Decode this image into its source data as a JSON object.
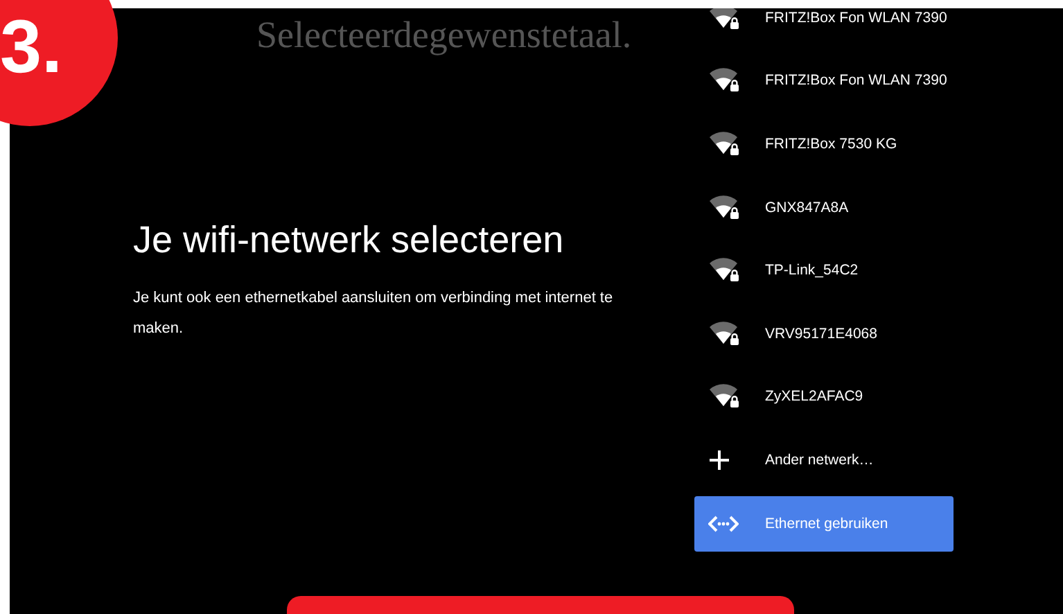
{
  "step_badge": "3.",
  "overlay_caption": "Selecteerdegewenstetaal.",
  "heading": "Je wifi-netwerk selecteren",
  "description": "Je kunt ook een ethernetkabel aansluiten om verbinding met internet te maken.",
  "networks": [
    {
      "kind": "wifi",
      "label": "FRITZ!Box Fon WLAN 7390",
      "selected": false
    },
    {
      "kind": "wifi",
      "label": "FRITZ!Box Fon WLAN 7390",
      "selected": false
    },
    {
      "kind": "wifi",
      "label": "FRITZ!Box 7530 KG",
      "selected": false
    },
    {
      "kind": "wifi",
      "label": "GNX847A8A",
      "selected": false
    },
    {
      "kind": "wifi",
      "label": "TP-Link_54C2",
      "selected": false
    },
    {
      "kind": "wifi",
      "label": "VRV95171E4068",
      "selected": false
    },
    {
      "kind": "wifi",
      "label": "ZyXEL2AFAC9",
      "selected": false
    },
    {
      "kind": "add",
      "label": "Ander netwerk…",
      "selected": false
    },
    {
      "kind": "ethernet",
      "label": "Ethernet gebruiken",
      "selected": true
    }
  ]
}
